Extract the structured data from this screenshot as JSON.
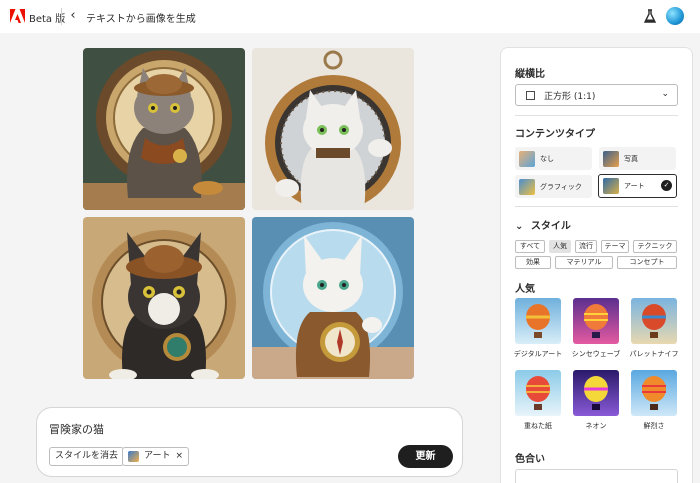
{
  "topbar": {
    "beta_label": "Beta 版",
    "page_title": "テキストから画像を生成"
  },
  "prompt": {
    "text": "冒険家の猫",
    "clear_style_label": "スタイルを消去",
    "art_chip_label": "アート",
    "art_chip_remove": "×",
    "update_label": "更新"
  },
  "panel": {
    "aspect_heading": "縦横比",
    "aspect_value": "正方形 (1:1)",
    "content_heading": "コンテンツタイプ",
    "content_types": [
      {
        "label": "なし",
        "selected": false
      },
      {
        "label": "写真",
        "selected": false
      },
      {
        "label": "グラフィック",
        "selected": false
      },
      {
        "label": "アート",
        "selected": true
      }
    ],
    "style_heading": "スタイル",
    "style_tabs": [
      "すべて",
      "人気",
      "流行",
      "テーマ",
      "テクニック",
      "効果",
      "マテリアル",
      "コンセプト"
    ],
    "style_tab_active": "人気",
    "popular_heading": "人気",
    "popular_styles": [
      "デジタルアート",
      "シンセウェーブ",
      "パレットナイフ",
      "重ねた紙",
      "ネオン",
      "鮮烈さ"
    ],
    "color_heading": "色合い"
  },
  "colors": {
    "accent_dark": "#1f1f1f",
    "adobe_red": "#eb1000"
  }
}
